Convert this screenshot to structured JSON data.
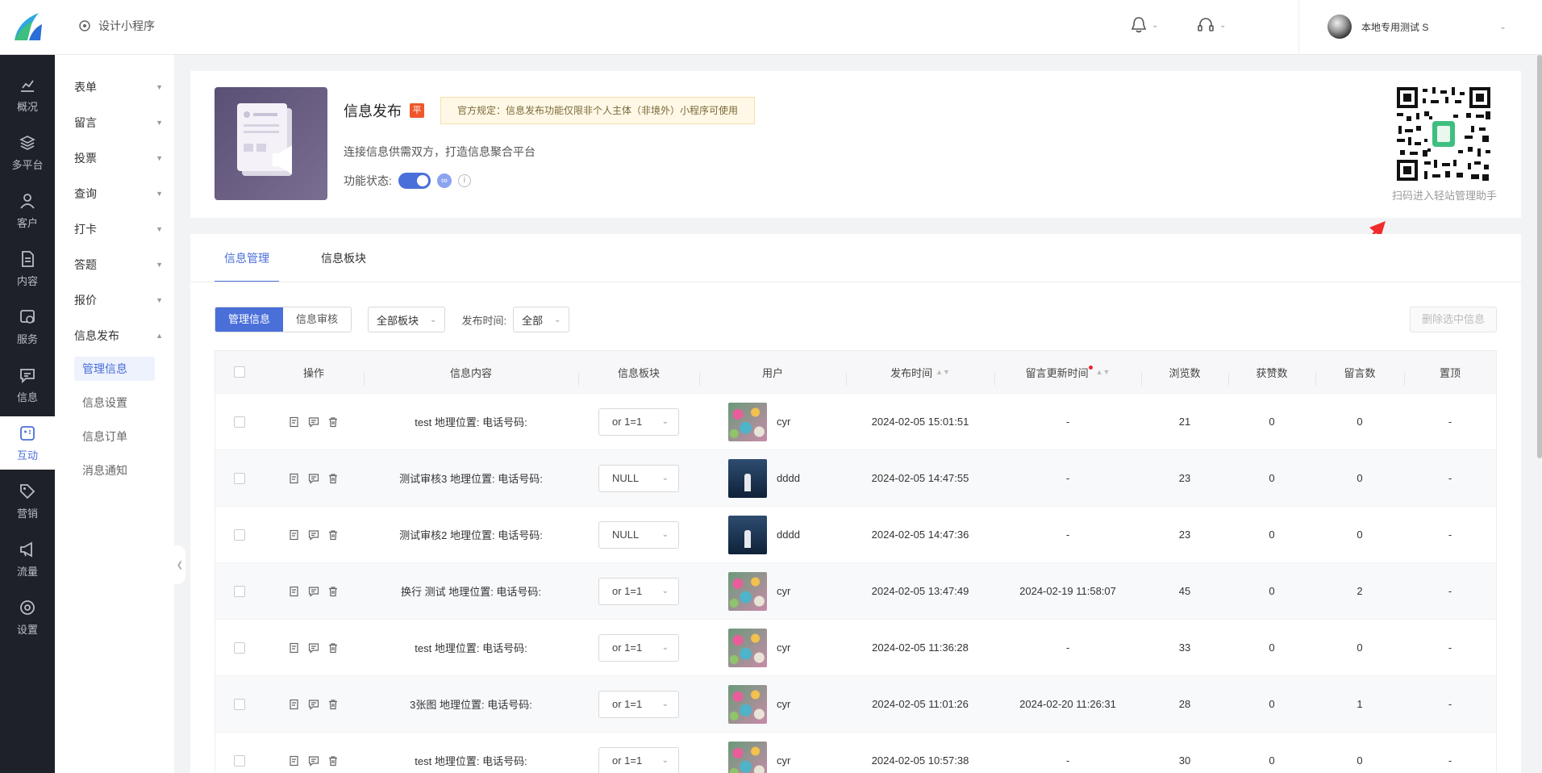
{
  "topbar": {
    "design_label": "设计小程序",
    "user_name": "本地专用测试 S"
  },
  "leftnav": [
    {
      "label": "概况",
      "icon": "chart-icon"
    },
    {
      "label": "多平台",
      "icon": "layers-icon"
    },
    {
      "label": "客户",
      "icon": "user-icon"
    },
    {
      "label": "内容",
      "icon": "document-icon"
    },
    {
      "label": "服务",
      "icon": "service-icon"
    },
    {
      "label": "信息",
      "icon": "message-icon"
    },
    {
      "label": "互动",
      "icon": "interact-icon"
    },
    {
      "label": "营销",
      "icon": "tag-icon"
    },
    {
      "label": "流量",
      "icon": "megaphone-icon"
    },
    {
      "label": "设置",
      "icon": "gear-icon"
    }
  ],
  "subnav": {
    "groups": [
      "表单",
      "留言",
      "投票",
      "查询",
      "打卡",
      "答题",
      "报价",
      "信息发布"
    ],
    "items": [
      "管理信息",
      "信息设置",
      "信息订单",
      "消息通知"
    ]
  },
  "feature": {
    "title": "信息发布",
    "badge": "平",
    "notice": "官方规定：信息发布功能仅限非个人主体（非境外）小程序可使用",
    "desc": "连接信息供需双方，打造信息聚合平台",
    "status_label": "功能状态:",
    "qr_caption": "扫码进入轻站管理助手"
  },
  "tabs": [
    "信息管理",
    "信息板块"
  ],
  "toolbar": {
    "seg_manage": "管理信息",
    "seg_review": "信息审核",
    "board_select": "全部板块",
    "time_label": "发布时间:",
    "time_select": "全部",
    "delete_btn": "删除选中信息"
  },
  "table": {
    "headers": [
      "操作",
      "信息内容",
      "信息板块",
      "用户",
      "发布时间",
      "留言更新时间",
      "浏览数",
      "获赞数",
      "留言数",
      "置顶"
    ],
    "rows": [
      {
        "content": "test 地理位置: 电话号码:",
        "board": "or 1=1",
        "user": "cyr",
        "avatar": "flowers",
        "time": "2024-02-05 15:01:51",
        "msg_time": "-",
        "views": "21",
        "likes": "0",
        "comments": "0",
        "top": "-"
      },
      {
        "content": "测试审核3 地理位置: 电话号码:",
        "board": "NULL",
        "user": "dddd",
        "avatar": "night",
        "time": "2024-02-05 14:47:55",
        "msg_time": "-",
        "views": "23",
        "likes": "0",
        "comments": "0",
        "top": "-"
      },
      {
        "content": "测试审核2 地理位置: 电话号码:",
        "board": "NULL",
        "user": "dddd",
        "avatar": "night",
        "time": "2024-02-05 14:47:36",
        "msg_time": "-",
        "views": "23",
        "likes": "0",
        "comments": "0",
        "top": "-"
      },
      {
        "content": "换行 测试 地理位置: 电话号码:",
        "board": "or 1=1",
        "user": "cyr",
        "avatar": "flowers",
        "time": "2024-02-05 13:47:49",
        "msg_time": "2024-02-19 11:58:07",
        "views": "45",
        "likes": "0",
        "comments": "2",
        "top": "-"
      },
      {
        "content": "test 地理位置: 电话号码:",
        "board": "or 1=1",
        "user": "cyr",
        "avatar": "flowers",
        "time": "2024-02-05 11:36:28",
        "msg_time": "-",
        "views": "33",
        "likes": "0",
        "comments": "0",
        "top": "-"
      },
      {
        "content": "3张图 地理位置: 电话号码:",
        "board": "or 1=1",
        "user": "cyr",
        "avatar": "flowers",
        "time": "2024-02-05 11:01:26",
        "msg_time": "2024-02-20 11:26:31",
        "views": "28",
        "likes": "0",
        "comments": "1",
        "top": "-"
      },
      {
        "content": "test 地理位置: 电话号码:",
        "board": "or 1=1",
        "user": "cyr",
        "avatar": "flowers",
        "time": "2024-02-05 10:57:38",
        "msg_time": "-",
        "views": "30",
        "likes": "0",
        "comments": "0",
        "top": "-"
      }
    ]
  },
  "colors": {
    "accent": "#4a6fd9",
    "nav_bg": "#1f2129",
    "badge": "#f0572b"
  }
}
